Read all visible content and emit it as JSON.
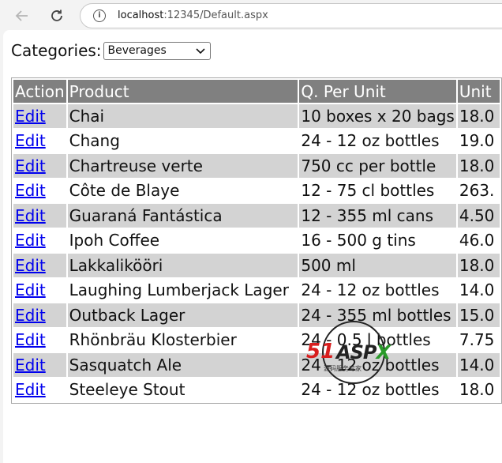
{
  "browser": {
    "url_host": "localhost",
    "url_rest": ":12345/Default.aspx"
  },
  "filter": {
    "label": "Categories:",
    "selected": "Beverages"
  },
  "grid": {
    "headers": [
      "Action",
      "Product",
      "Q. Per Unit",
      "Unit"
    ],
    "rows": [
      {
        "action": "Edit",
        "product": "Chai",
        "qty": "10 boxes x 20 bags",
        "unit": "18.0"
      },
      {
        "action": "Edit",
        "product": "Chang",
        "qty": "24 - 12 oz bottles",
        "unit": "19.0"
      },
      {
        "action": "Edit",
        "product": "Chartreuse verte",
        "qty": "750 cc per bottle",
        "unit": "18.0"
      },
      {
        "action": "Edit",
        "product": "Côte de Blaye",
        "qty": "12 - 75 cl bottles",
        "unit": "263."
      },
      {
        "action": "Edit",
        "product": "Guaraná Fantástica",
        "qty": "12 - 355 ml cans",
        "unit": "4.50"
      },
      {
        "action": "Edit",
        "product": "Ipoh Coffee",
        "qty": "16 - 500 g tins",
        "unit": "46.0"
      },
      {
        "action": "Edit",
        "product": "Lakkalikööri",
        "qty": "500 ml",
        "unit": "18.0"
      },
      {
        "action": "Edit",
        "product": "Laughing Lumberjack Lager",
        "qty": "24 - 12 oz bottles",
        "unit": "14.0"
      },
      {
        "action": "Edit",
        "product": "Outback Lager",
        "qty": "24 - 355 ml bottles",
        "unit": "15.0"
      },
      {
        "action": "Edit",
        "product": "Rhönbräu Klosterbier",
        "qty": "24 - 0.5 l bottles",
        "unit": "7.75"
      },
      {
        "action": "Edit",
        "product": "Sasquatch Ale",
        "qty": "24 - 12 oz bottles",
        "unit": "14.0"
      },
      {
        "action": "Edit",
        "product": "Steeleye Stout",
        "qty": "24 - 12 oz bottles",
        "unit": "18.0"
      }
    ]
  },
  "watermark": {
    "brand_51": "51",
    "brand_asp": "ASP",
    "brand_x": "X",
    "tagline": "源码服务专家"
  },
  "icons": {
    "back": "back-arrow-icon",
    "reload": "reload-icon",
    "info": "info-icon",
    "dropdown": "chevron-down-icon"
  },
  "colors": {
    "header_bg": "#808080",
    "alt_row_bg": "#d3d3d3",
    "link": "#0000ee"
  }
}
